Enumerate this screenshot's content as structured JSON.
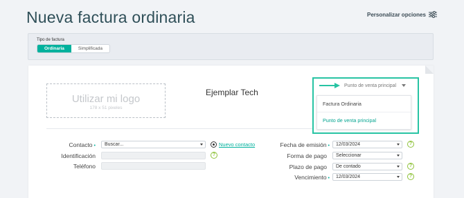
{
  "header": {
    "title": "Nueva factura ordinaria",
    "customize_label": "Personalizar opciones",
    "customize_icon": "sliders-icon"
  },
  "invoice_type": {
    "label": "Tipo de factura",
    "options": [
      "Ordinaria",
      "Simplificada"
    ],
    "selected": "Ordinaria"
  },
  "logo": {
    "title": "Utilizar mi logo",
    "size": "178 x 51 pixeles"
  },
  "company_name": "Ejemplar Tech",
  "point_of_sale": {
    "current": "Punto de venta principal",
    "options": [
      "Factura Ordinaria",
      "Punto de venta principal"
    ],
    "highlight_color": "#27c3a3"
  },
  "left_form": {
    "contact_label": "Contacto",
    "contact_placeholder": "Buscar...",
    "new_contact_label": "Nuevo contacto",
    "identification_label": "Identificación",
    "phone_label": "Teléfono"
  },
  "right_form": {
    "issue_date_label": "Fecha de emisión",
    "issue_date_value": "12/03/2024",
    "payment_method_label": "Forma de pago",
    "payment_method_value": "Seleccionar",
    "payment_term_label": "Plazo de pago",
    "payment_term_value": "De contado",
    "due_date_label": "Vencimiento",
    "due_date_value": "12/03/2024"
  },
  "required_marker": "•",
  "help_glyph": "?",
  "colors": {
    "accent": "#00b19d",
    "help": "#8fc23b",
    "title": "#2f4f58"
  }
}
